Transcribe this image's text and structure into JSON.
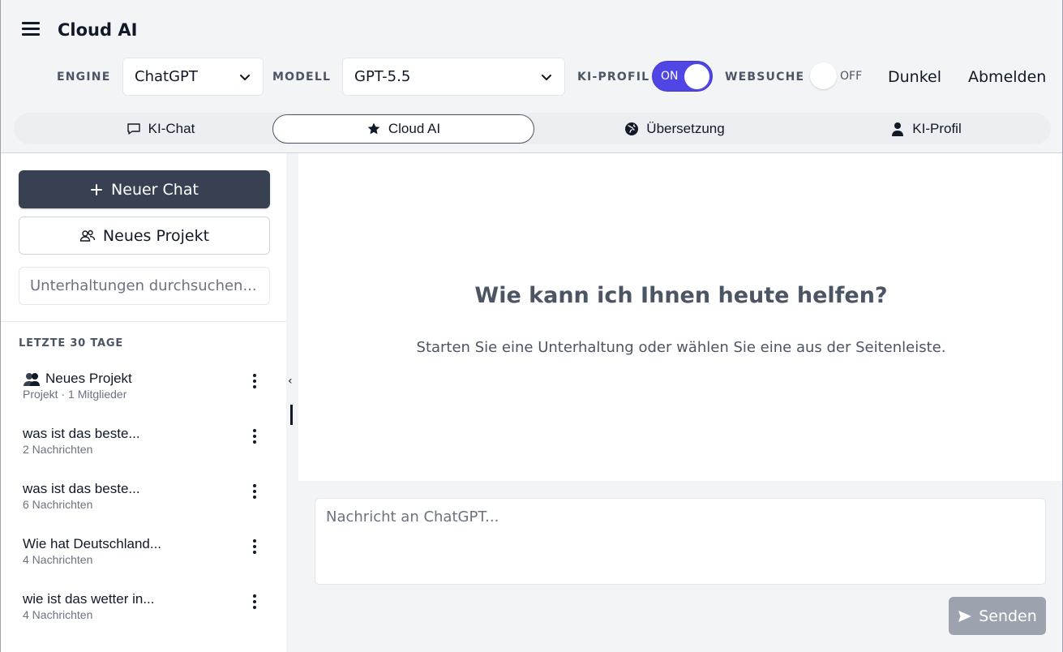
{
  "app": {
    "title": "Cloud AI"
  },
  "controls": {
    "engine_label": "ENGINE",
    "engine_value": "ChatGPT",
    "model_label": "MODELL",
    "model_value": "GPT-5.5",
    "profile_label": "KI-PROFIL",
    "profile_toggle": "ON",
    "websearch_label": "WEBSUCHE",
    "websearch_toggle": "OFF",
    "theme_link": "Dunkel",
    "logout_link": "Abmelden"
  },
  "tabs": [
    {
      "label": "KI-Chat",
      "icon": "chat-bubble-icon"
    },
    {
      "label": "Cloud AI",
      "icon": "star-icon"
    },
    {
      "label": "Übersetzung",
      "icon": "globe-icon"
    },
    {
      "label": "KI-Profil",
      "icon": "user-icon"
    }
  ],
  "active_tab": "Cloud AI",
  "sidebar": {
    "new_chat": "Neuer Chat",
    "new_project": "Neues Projekt",
    "search_placeholder": "Unterhaltungen durchsuchen...",
    "section_label": "LETZTE 30 TAGE",
    "items": [
      {
        "title": "Neues Projekt",
        "subtitle": "Projekt · 1 Mitglieder",
        "icon": "group-icon"
      },
      {
        "title": "was ist das beste...",
        "subtitle": "2 Nachrichten"
      },
      {
        "title": "was ist das beste...",
        "subtitle": "6 Nachrichten"
      },
      {
        "title": "Wie hat Deutschland...",
        "subtitle": "4 Nachrichten"
      },
      {
        "title": "wie ist das wetter in...",
        "subtitle": "4 Nachrichten"
      }
    ],
    "collapse_glyph": "‹"
  },
  "main": {
    "welcome_title": "Wie kann ich Ihnen heute helfen?",
    "welcome_subtitle": "Starten Sie eine Unterhaltung oder wählen Sie eine aus der Seitenleiste.",
    "message_placeholder": "Nachricht an ChatGPT...",
    "send_label": "Senden"
  },
  "colors": {
    "accent": "#4f46e5",
    "primary_button": "#374151",
    "send_button_disabled": "#9ca3af"
  }
}
